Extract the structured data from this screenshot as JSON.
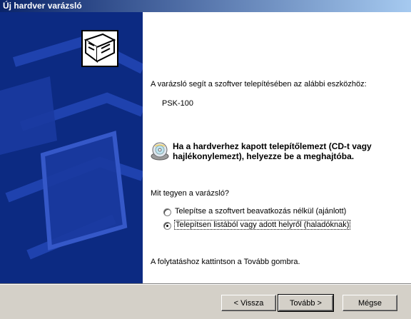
{
  "window": {
    "title": "Új hardver varázsló"
  },
  "content": {
    "intro": "A varázsló segít a szoftver telepítésében az alábbi eszközhöz:",
    "device": "PSK-100",
    "disc_note": "Ha a hardverhez kapott telepítőlemezt (CD-t vagy hajlékonylemezt), helyezze be a meghajtóba.",
    "question": "Mit tegyen a varázsló?",
    "options": [
      {
        "label": "Telepítse a szoftvert beavatkozás nélkül (ajánlott)",
        "selected": false
      },
      {
        "label": "Telepítsen listából vagy adott helyről (haladóknak)",
        "selected": true
      }
    ],
    "footer_note": "A folytatáshoz kattintson a Tovább gombra."
  },
  "buttons": {
    "back": "< Vissza",
    "next": "Tovább >",
    "cancel": "Mégse"
  },
  "colors": {
    "sidebar": "#0c2a82",
    "titlebar": "#0a246a",
    "face": "#d4d0c8"
  }
}
